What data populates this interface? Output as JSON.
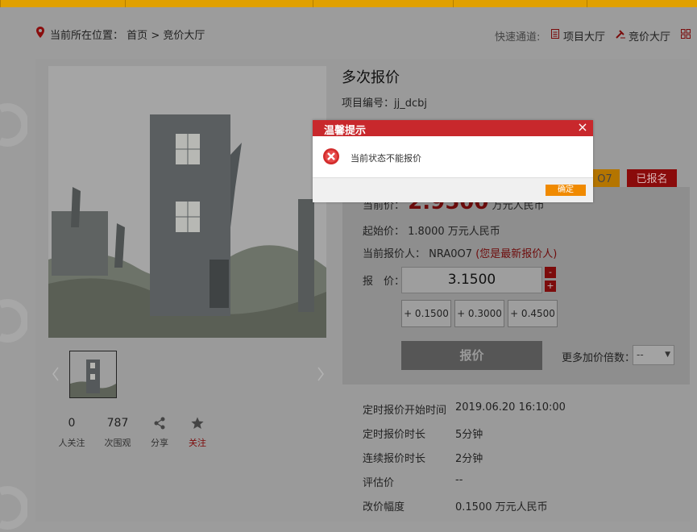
{
  "breadcrumb": {
    "label": "当前所在位置：",
    "home": "首页",
    "sep": ">",
    "current": "竞价大厅"
  },
  "quick_access": {
    "label": "快速通道:",
    "links": [
      "项目大厅",
      "竞价大厅"
    ]
  },
  "project": {
    "title": "多次报价",
    "code_label": "项目编号：",
    "code": "jj_dcbj"
  },
  "badges": {
    "bidder": "O7",
    "registered": "已报名"
  },
  "stats": [
    {
      "num": "0",
      "label": "人关注"
    },
    {
      "num": "787",
      "label": "次围观"
    },
    {
      "label": "分享"
    },
    {
      "label": "关注"
    }
  ],
  "bid": {
    "current_label": "当前价：",
    "current_value": "2.9500",
    "unit": "万元人民币",
    "start_label": "起始价：",
    "start_value": "1.8000 万元人民币",
    "bidder_label": "当前报价人：",
    "bidder_value": "NRA0O7",
    "bidder_note": "(您是最新报价人)",
    "price_label": "报　价：",
    "price_value": "3.1500",
    "minus": "-",
    "plus": "+",
    "increments": [
      "+ 0.1500",
      "+ 0.3000",
      "+ 0.4500"
    ],
    "submit": "报价",
    "multiple_label": "更多加价倍数：",
    "multiple_value": "--"
  },
  "info_rows": [
    {
      "label": "定时报价开始时间",
      "value": "2019.06.20 16:10:00"
    },
    {
      "label": "定时报价时长",
      "value": "5分钟"
    },
    {
      "label": "连续报价时长",
      "value": "2分钟"
    },
    {
      "label": "评估价",
      "value": "--"
    },
    {
      "label": "改价幅度",
      "value": "0.1500 万元人民币"
    }
  ],
  "modal": {
    "title": "温馨提示",
    "message": "当前状态不能报价",
    "ok": "确定"
  }
}
